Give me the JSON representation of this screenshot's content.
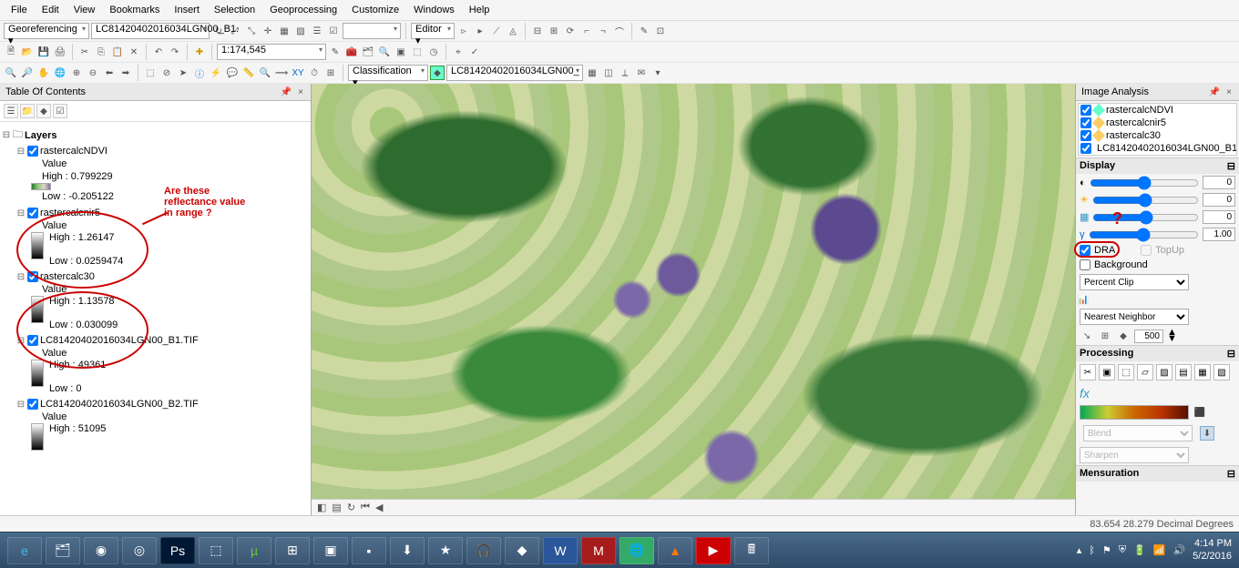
{
  "menubar": [
    "File",
    "Edit",
    "View",
    "Bookmarks",
    "Insert",
    "Selection",
    "Geoprocessing",
    "Customize",
    "Windows",
    "Help"
  ],
  "toolbar1": {
    "georef": "Georeferencing ▾",
    "file_dd": "LC81420402016034LGN00_B1."
  },
  "toolbar2": {
    "scale": "1:174,545",
    "editor": "Editor ▾"
  },
  "toolbar3": {
    "classif": "Classification ▾",
    "layer_dd": "LC81420402016034LGN00_"
  },
  "toc_title": "Table Of Contents",
  "layers_root": "Layers",
  "layers": [
    {
      "name": "rastercalcNDVI",
      "value": "Value",
      "high": "High : 0.799229",
      "low": "Low : -0.205122",
      "type": "ndvi"
    },
    {
      "name": "rastercalcnir5",
      "value": "Value",
      "high": "High : 1.26147",
      "low": "Low : 0.0259474",
      "type": "gray"
    },
    {
      "name": "rastercalc30",
      "value": "Value",
      "high": "High : 1.13578",
      "low": "Low : 0.030099",
      "type": "gray"
    },
    {
      "name": "LC81420402016034LGN00_B1.TIF",
      "value": "Value",
      "high": "High : 49361",
      "low": "Low : 0",
      "type": "gray"
    },
    {
      "name": "LC81420402016034LGN00_B2.TIF",
      "value": "Value",
      "high": "High : 51095",
      "low": "",
      "type": "gray"
    }
  ],
  "annot": {
    "l1": "Are these",
    "l2": "reflectance value",
    "l3": "in range ?",
    "q": "?"
  },
  "ia_title": "Image Analysis",
  "ia_layers": [
    {
      "label": "rastercalcNDVI",
      "color": "#6fc"
    },
    {
      "label": "rastercalcnir5",
      "color": "#fc6"
    },
    {
      "label": "rastercalc30",
      "color": "#fc6"
    },
    {
      "label": "LC81420402016034LGN00_B1.TIF",
      "color": "#8f8"
    }
  ],
  "display": {
    "title": "Display",
    "brightness": "0",
    "contrast": "0",
    "saturation": "0",
    "gamma": "1.00",
    "dra": "DRA",
    "topup": "TopUp",
    "background": "Background",
    "stretch": "Percent Clip",
    "resample": "Nearest Neighbor",
    "zoom": "500"
  },
  "processing": {
    "title": "Processing",
    "blend": "Blend",
    "sharpen": "Sharpen"
  },
  "mensuration_title": "Mensuration",
  "status": {
    "coords": "83.654  28.279 Decimal Degrees"
  },
  "map_bottom": {
    "i1": "◧",
    "i2": "▤",
    "i3": "↻",
    "i4": "⏮",
    "i5": "◀"
  },
  "tray": {
    "time": "4:14 PM",
    "date": "5/2/2016"
  }
}
